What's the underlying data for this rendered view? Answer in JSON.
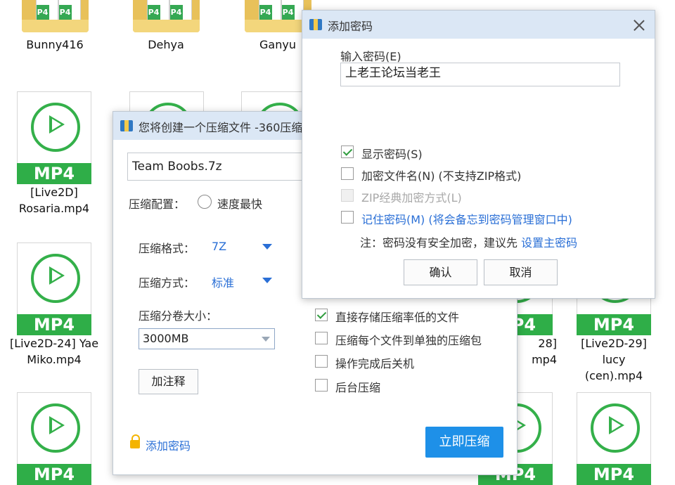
{
  "desktop": {
    "folders": [
      {
        "name": "Bunny416",
        "badge": "P4"
      },
      {
        "name": "Dehya",
        "badge": "P4"
      },
      {
        "name": "Ganyu",
        "badge": "P4"
      }
    ],
    "file_badge": "MP4",
    "files": [
      {
        "line1": "[Live2D]",
        "line2": "Rosaria.mp4"
      },
      {
        "line1": "[Live2D-24] Yae",
        "line2": "Miko.mp4"
      },
      {
        "line1": "28]",
        "line2": "mp4"
      },
      {
        "line1": "[Live2D-29] lucy",
        "line2": "(cen).mp4"
      }
    ]
  },
  "compress_dialog": {
    "title": "您将创建一个压缩文件 -360压缩",
    "filename": "Team Boobs.7z",
    "config_label": "压缩配置：",
    "config_option": "速度最快",
    "format_label": "压缩格式：",
    "format_value": "7Z",
    "method_label": "压缩方式：",
    "method_value": "标准",
    "volume_label": "压缩分卷大小：",
    "volume_value": "3000MB",
    "comment_button": "加注释",
    "add_password_link": "添加密码",
    "compress_button": "立即压缩",
    "options": [
      {
        "label": "直接存储压缩率低的文件",
        "checked": true
      },
      {
        "label": "压缩每个文件到单独的压缩包",
        "checked": false
      },
      {
        "label": "操作完成后关机",
        "checked": false
      },
      {
        "label": "后台压缩",
        "checked": false
      }
    ]
  },
  "password_dialog": {
    "title": "添加密码",
    "input_label": "输入密码(E)",
    "password_value": "上老王论坛当老王",
    "show_password": "显示密码(S)",
    "encrypt_filenames": "加密文件名(N) (不支持ZIP格式)",
    "zip_classic": "ZIP经典加密方式(L)",
    "remember_password": "记住密码(M) (将会备忘到密码管理窗口中)",
    "note_prefix": "注：密码没有安全加密，建议先 ",
    "note_link": "设置主密码",
    "ok_button": "确认",
    "cancel_button": "取消"
  },
  "colors": {
    "accent": "#1e90e8",
    "link": "#2a6fd6",
    "mp4_green": "#2fae48",
    "titlebar": "#dbe7f5"
  }
}
